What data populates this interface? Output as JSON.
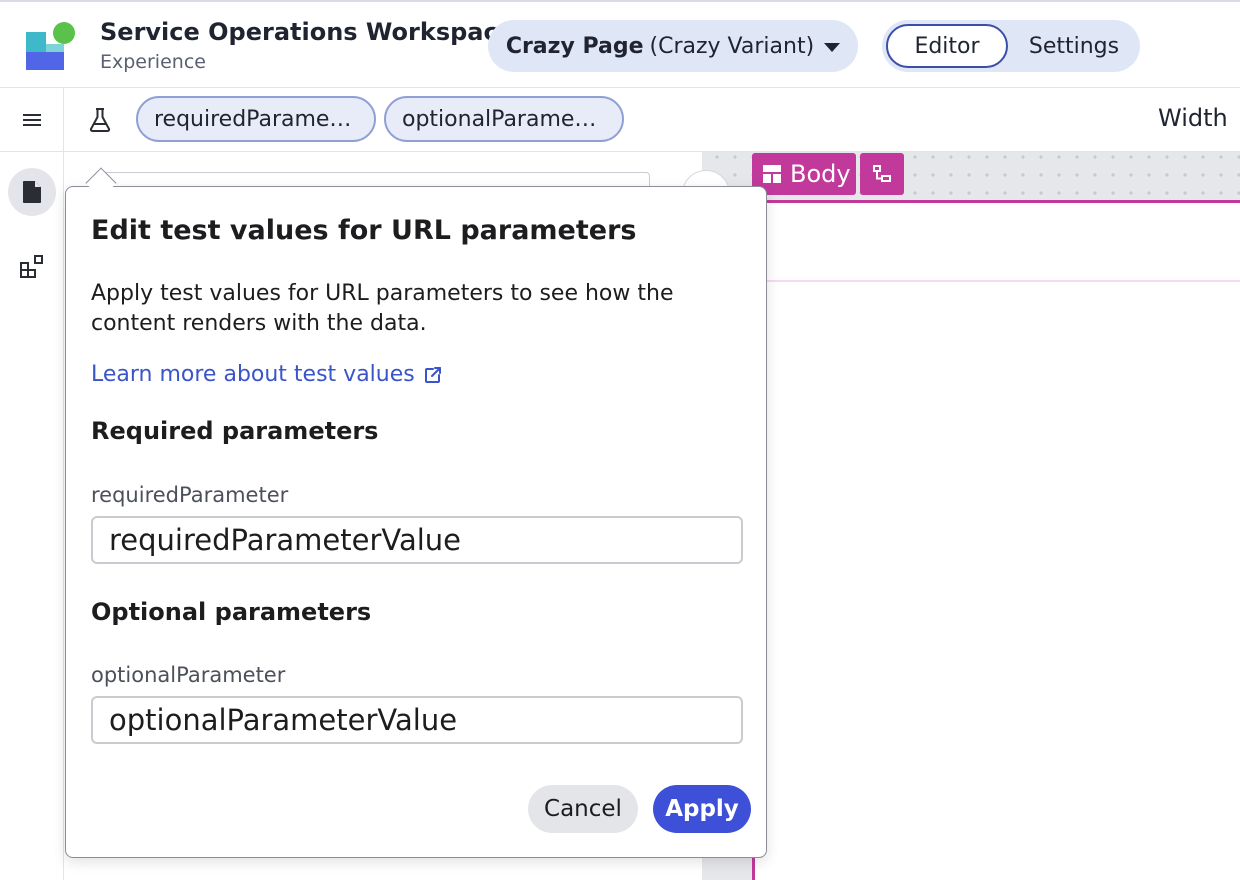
{
  "header": {
    "app_title": "Service Operations Workspace",
    "app_subtitle": "Experience",
    "page_selector": {
      "page_name": "Crazy Page",
      "variant": "(Crazy Variant)"
    },
    "modes": {
      "editor": "Editor",
      "settings": "Settings",
      "active": "Editor"
    }
  },
  "toolbar": {
    "chips": {
      "required": "requiredParame…",
      "optional": "optionalParame…"
    },
    "width_label": "Width"
  },
  "canvas": {
    "body_tag": "Body",
    "accent_color": "#c2399c"
  },
  "popover": {
    "title": "Edit test values for URL parameters",
    "description": "Apply test values for URL parameters to see how the content renders with the data.",
    "learn_more": "Learn more about test values",
    "required_section": {
      "heading": "Required parameters",
      "field_label": "requiredParameter",
      "field_value": "requiredParameterValue"
    },
    "optional_section": {
      "heading": "Optional parameters",
      "field_label": "optionalParameter",
      "field_value": "optionalParameterValue"
    },
    "cancel_label": "Cancel",
    "apply_label": "Apply"
  },
  "colors": {
    "primary": "#3e50d8",
    "link": "#3a55c9",
    "chip_bg": "#e7ecf8",
    "selector_bg": "#dfe6f5"
  },
  "icons": [
    "app-logo",
    "hamburger-icon",
    "flask-icon",
    "page-icon",
    "components-icon",
    "body-layout-icon",
    "tree-icon",
    "external-link-icon",
    "caret-down-icon"
  ]
}
